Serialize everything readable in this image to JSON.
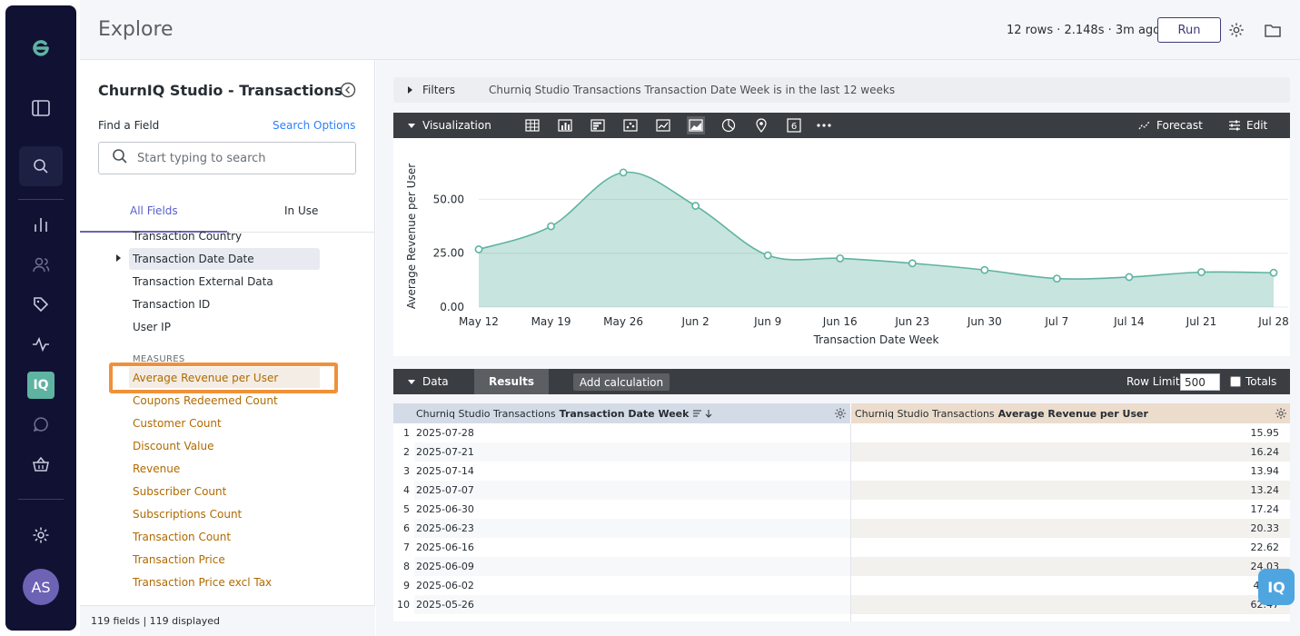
{
  "header": {
    "title": "Explore",
    "meta": "12 rows · 2.148s · 3m ago",
    "run_label": "Run"
  },
  "rail": {
    "avatar_initials": "AS",
    "iq_label": "IQ"
  },
  "picker": {
    "title": "ChurnIQ Studio - Transactions",
    "find_label": "Find a Field",
    "search_options": "Search Options",
    "search_placeholder": "Start typing to search",
    "tabs": {
      "all": "All Fields",
      "in_use": "In Use"
    },
    "dimensions": [
      "Transaction Country",
      "Transaction Date Date",
      "Transaction External Data",
      "Transaction ID",
      "User IP"
    ],
    "measures_label": "MEASURES",
    "measures": [
      "Average Revenue per User",
      "Coupons Redeemed Count",
      "Customer Count",
      "Discount Value",
      "Revenue",
      "Subscriber Count",
      "Subscriptions Count",
      "Transaction Count",
      "Transaction Price",
      "Transaction Price excl Tax"
    ],
    "footer": "119 fields | 119 displayed"
  },
  "filters": {
    "label": "Filters",
    "description": "Churniq Studio Transactions Transaction Date Week is in the last 12 weeks"
  },
  "visualization": {
    "label": "Visualization",
    "forecast": "Forecast",
    "edit": "Edit",
    "single_value_glyph": "6"
  },
  "chart_data": {
    "type": "area",
    "categories": [
      "May 12",
      "May 19",
      "May 26",
      "Jun 2",
      "Jun 9",
      "Jun 16",
      "Jun 23",
      "Jun 30",
      "Jul 7",
      "Jul 14",
      "Jul 21",
      "Jul 28"
    ],
    "series": [
      {
        "values": [
          26.8,
          37.5,
          62.47,
          47.0,
          24.03,
          22.62,
          20.33,
          17.24,
          13.24,
          13.94,
          16.24,
          15.95
        ]
      }
    ],
    "xlabel": "Transaction Date Week",
    "ylabel": "Average Revenue per User",
    "yticks": [
      "0.00",
      "25.00",
      "50.00"
    ],
    "ylim": [
      0,
      70
    ],
    "grid": true,
    "color": "#5fb3a1"
  },
  "data_panel": {
    "label": "Data",
    "results_tab": "Results",
    "add_calculation": "Add calculation",
    "row_limit_label": "Row Limit",
    "row_limit_value": "500",
    "totals_label": "Totals"
  },
  "table": {
    "dim_header_prefix": "Churniq Studio Transactions",
    "dim_header_field": "Transaction Date Week",
    "measure_header_prefix": "Churniq Studio Transactions",
    "measure_header_field": "Average Revenue per User",
    "rows": [
      {
        "n": "1",
        "date": "2025-07-28",
        "value": "15.95"
      },
      {
        "n": "2",
        "date": "2025-07-21",
        "value": "16.24"
      },
      {
        "n": "3",
        "date": "2025-07-14",
        "value": "13.94"
      },
      {
        "n": "4",
        "date": "2025-07-07",
        "value": "13.24"
      },
      {
        "n": "5",
        "date": "2025-06-30",
        "value": "17.24"
      },
      {
        "n": "6",
        "date": "2025-06-23",
        "value": "20.33"
      },
      {
        "n": "7",
        "date": "2025-06-16",
        "value": "22.62"
      },
      {
        "n": "8",
        "date": "2025-06-09",
        "value": "24.03"
      },
      {
        "n": "9",
        "date": "2025-06-02",
        "value": "47.__"
      },
      {
        "n": "10",
        "date": "2025-05-26",
        "value": "62.47"
      }
    ]
  }
}
